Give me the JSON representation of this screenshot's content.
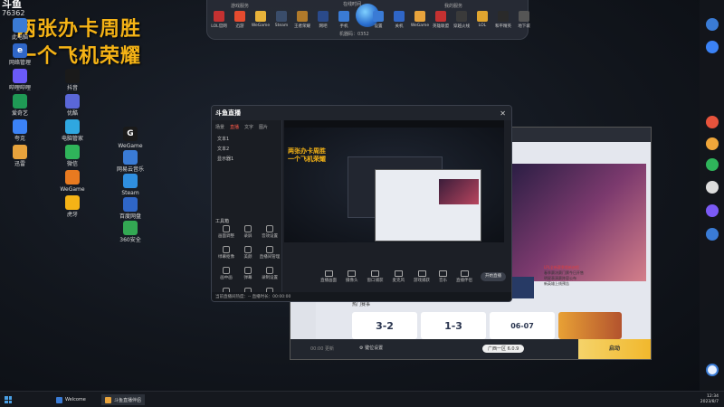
{
  "watermark": {
    "logo": "斗鱼",
    "id": "76362"
  },
  "overlay": {
    "line1": "两张办卡周胜",
    "line2": "一个飞机荣耀"
  },
  "desktop_left": [
    {
      "label": "此电脑",
      "color": "#3a7bd5",
      "glyph": ""
    },
    {
      "label": "网络管理",
      "color": "#2f66c7",
      "glyph": "e"
    },
    {
      "label": "哔哩哔哩",
      "color": "#6a5af9",
      "glyph": ""
    },
    {
      "label": "爱奇艺",
      "color": "#1f9a55",
      "glyph": ""
    },
    {
      "label": "夸克",
      "color": "#3b82f6",
      "glyph": ""
    },
    {
      "label": "迅雷",
      "color": "#e8a33c",
      "glyph": ""
    },
    {
      "label": "抖音",
      "color": "#1a1a1a",
      "glyph": ""
    },
    {
      "label": "优酷",
      "color": "#5a67d8",
      "glyph": ""
    },
    {
      "label": "电脑管家",
      "color": "#2fa7e0",
      "glyph": ""
    },
    {
      "label": "微信",
      "color": "#2fb45a",
      "glyph": ""
    },
    {
      "label": "WeGame",
      "color": "#e87a20",
      "glyph": ""
    },
    {
      "label": "虎牙",
      "color": "#f5b316",
      "glyph": ""
    }
  ],
  "desktop_mid": [
    {
      "label": "WeGame",
      "color": "#1a1a1a",
      "glyph": "G"
    },
    {
      "label": "网易云音乐",
      "color": "#3a7bd5",
      "glyph": ""
    },
    {
      "label": "Steam",
      "color": "#2f8fe0",
      "glyph": ""
    },
    {
      "label": "百度网盘",
      "color": "#2f66c7",
      "glyph": ""
    },
    {
      "label": "360安全",
      "color": "#33a853",
      "glyph": ""
    }
  ],
  "topbar": {
    "left_label": "游戏服务",
    "right_label": "我的服务",
    "clock_label": "在线时间",
    "center_bottom": "机器码：0352",
    "left_items": [
      {
        "label": "LOL官网",
        "color": "#c43131"
      },
      {
        "label": "迅游",
        "color": "#e54b2f"
      },
      {
        "label": "WeGame",
        "color": "#e8b33a"
      },
      {
        "label": "Steam",
        "color": "#3a4d6a"
      },
      {
        "label": "王者荣耀",
        "color": "#b07a2a"
      },
      {
        "label": "网吧",
        "color": "#2a4a8a"
      },
      {
        "label": "手机",
        "color": "#3a7bd5"
      }
    ],
    "right_items": [
      {
        "label": "设置",
        "color": "#3a7bd5"
      },
      {
        "label": "关机",
        "color": "#2f66c7"
      },
      {
        "label": "WeGame",
        "color": "#e8a33c"
      },
      {
        "label": "英雄联盟",
        "color": "#c43131"
      },
      {
        "label": "穿越火线",
        "color": "#3a3a3a"
      },
      {
        "label": "LOL",
        "color": "#e0a52f"
      },
      {
        "label": "和平精英",
        "color": "#2a2a2a"
      },
      {
        "label": "地下城",
        "color": "#555"
      }
    ]
  },
  "main_window": {
    "app_name": "斗鱼直播",
    "tabs": [
      "场景",
      "直播",
      "文字",
      "图片"
    ],
    "scenes": [
      "文本1",
      "文本2",
      "显示器1"
    ],
    "tools_title": "工具箱",
    "tools": [
      "画面调整",
      "录屏",
      "音效设置",
      "绿幕抠像",
      "美颜",
      "直播间管理",
      "画中画",
      "弹幕",
      "录制设置",
      "连麦PK",
      "主播任务",
      "更多"
    ],
    "status": "当前直播间热度：-- 直播时长：00:00:00",
    "controls": [
      "直播画面",
      "摄像头",
      "窗口捕获",
      "麦克风",
      "游戏捕获",
      "音乐",
      "直播伴侣"
    ],
    "start_live": "开始直播"
  },
  "browser": {
    "news_highlight": "LPL全新赛季焕新启程",
    "news": [
      "春季赛决赛门票今日开售",
      "明星表演赛阵容公布",
      "新英雄上线预告"
    ],
    "match_title": "热门赛事",
    "matches": [
      "3-2",
      "1-3",
      "06-07"
    ],
    "promo": "",
    "bottom_left": "00:00 更新",
    "bottom_gear": "键位设置",
    "bottom_mid": "广西一区 6.0.9",
    "bottom_go": "启动"
  },
  "taskbar": {
    "items": [
      {
        "label": "Welcome",
        "color": "#3a7bd5"
      },
      {
        "label": "斗鱼直播伴侣",
        "color": "#e8a33c"
      }
    ],
    "time": "12:34",
    "date": "2023/8/7"
  }
}
